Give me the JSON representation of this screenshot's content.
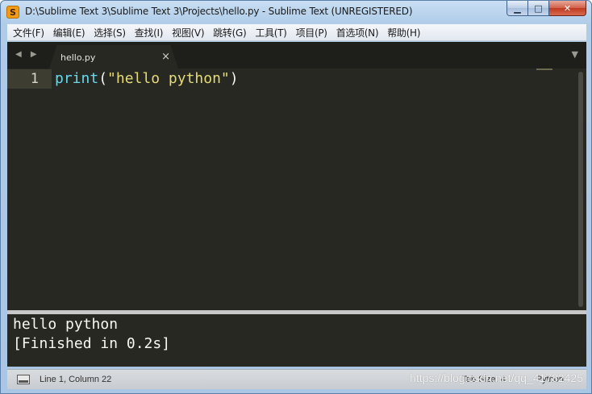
{
  "window": {
    "title": "D:\\Sublime Text 3\\Sublime Text 3\\Projects\\hello.py - Sublime Text (UNREGISTERED)",
    "app_icon_glyph": "S",
    "minimize_glyph": "▁",
    "maximize_glyph": "□",
    "close_glyph": "✕"
  },
  "menu": [
    {
      "label": "文件(F)"
    },
    {
      "label": "编辑(E)"
    },
    {
      "label": "选择(S)"
    },
    {
      "label": "查找(I)"
    },
    {
      "label": "视图(V)"
    },
    {
      "label": "跳转(G)"
    },
    {
      "label": "工具(T)"
    },
    {
      "label": "项目(P)"
    },
    {
      "label": "首选项(N)"
    },
    {
      "label": "帮助(H)"
    }
  ],
  "tabs": {
    "nav_arrows": "◀ ▶",
    "active": {
      "label": "hello.py",
      "close_glyph": "×"
    },
    "dropdown_glyph": "▼"
  },
  "editor": {
    "line_number": "1",
    "tokens": {
      "fn": "print",
      "open": "(",
      "str": "\"hello python\"",
      "close": ")"
    }
  },
  "output": {
    "lines": [
      "hello python",
      "[Finished in 0.2s]"
    ]
  },
  "statusbar": {
    "position": "Line 1, Column 22",
    "tab_size": "Tab Size: 4",
    "syntax": "Python"
  },
  "watermark": "https://blog.csdn.net/qq_41782425",
  "colors": {
    "editor_bg": "#272822",
    "function": "#66d9ef",
    "string": "#e6db74",
    "text": "#f8f8f2"
  },
  "icons": {
    "panel_toggle": "panel-icon",
    "app": "sublime-text-icon"
  }
}
